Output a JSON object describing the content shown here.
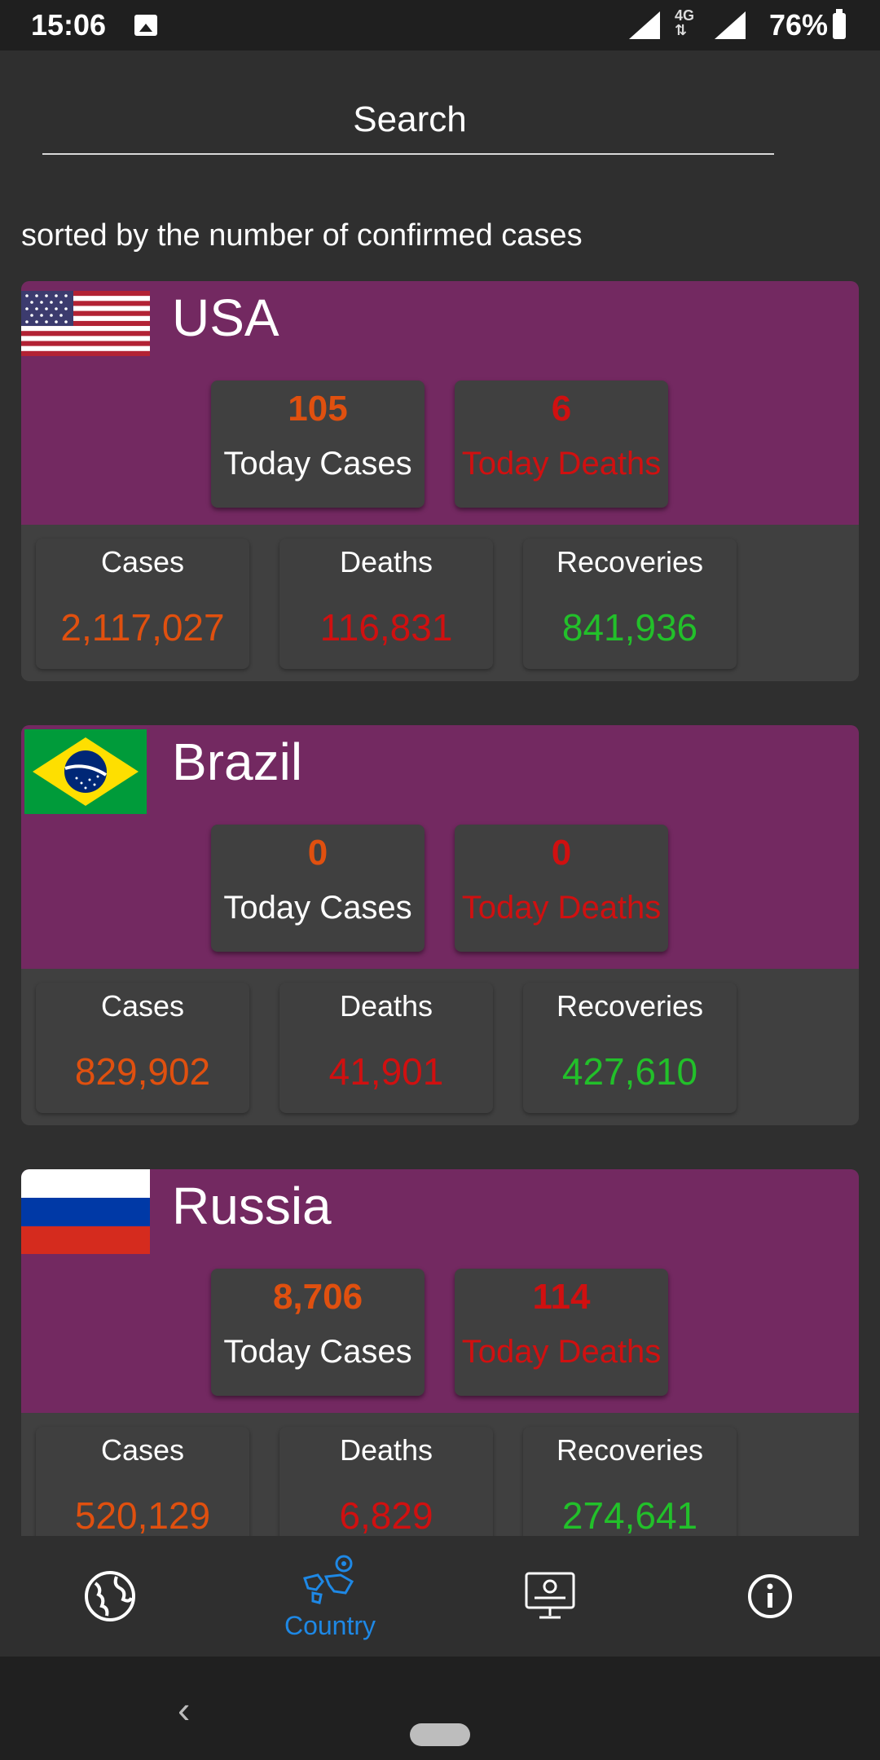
{
  "status_bar": {
    "time": "15:06",
    "network": "4G",
    "battery": "76%"
  },
  "search": {
    "placeholder": "Search"
  },
  "sort_note": "sorted by the number of confirmed cases",
  "labels": {
    "today_cases": "Today Cases",
    "today_deaths": "Today Deaths",
    "cases": "Cases",
    "deaths": "Deaths",
    "recoveries": "Recoveries"
  },
  "countries": [
    {
      "name": "USA",
      "today_cases": "105",
      "today_deaths": "6",
      "cases": "2,117,027",
      "deaths": "116,831",
      "recoveries": "841,936",
      "flag": "usa-flag"
    },
    {
      "name": "Brazil",
      "today_cases": "0",
      "today_deaths": "0",
      "cases": "829,902",
      "deaths": "41,901",
      "recoveries": "427,610",
      "flag": "brazil-flag"
    },
    {
      "name": "Russia",
      "today_cases": "8,706",
      "today_deaths": "114",
      "cases": "520,129",
      "deaths": "6,829",
      "recoveries": "274,641",
      "flag": "russia-flag"
    }
  ],
  "bottom_nav": [
    {
      "icon": "globe-icon",
      "label": ""
    },
    {
      "icon": "world-map-icon",
      "label": "Country",
      "active": true
    },
    {
      "icon": "monitor-icon",
      "label": ""
    },
    {
      "icon": "info-icon",
      "label": ""
    }
  ],
  "colors": {
    "card_header": "#732961",
    "cases": "#e0500f",
    "deaths": "#d01010",
    "recoveries": "#22c02a",
    "nav_active": "#1e88e5"
  }
}
